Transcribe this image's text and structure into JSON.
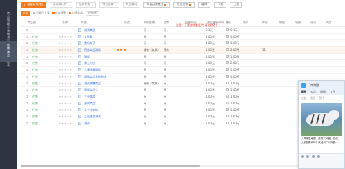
{
  "nav": {
    "groups": [
      {
        "chars": [
          "商",
          "品",
          "管",
          "理"
        ]
      },
      {
        "chars": [
          "订",
          "单",
          "物",
          "流"
        ]
      },
      {
        "chars": [
          "采",
          "购",
          "仓",
          "储"
        ]
      },
      {
        "chars": [
          "数",
          "据",
          "报",
          "表"
        ]
      }
    ],
    "active_chars": [
      "店",
      "铺",
      "商",
      "品"
    ]
  },
  "toolbar": {
    "add_label": "批量新增商品",
    "filters": [
      "请选择分类",
      "全部状态",
      "商品名称",
      "商品编码"
    ],
    "buttons": [
      "导出已选商品",
      "导出全部",
      "删除",
      "下架",
      "上架"
    ]
  },
  "row2": {
    "chip": "全部",
    "checks": [
      "只看已上架",
      "库存预警",
      "价格异常"
    ],
    "sort_label": "按排序"
  },
  "table": {
    "headers": [
      "商品图",
      "名称",
      "标题",
      "分类",
      "所属店铺",
      "品牌",
      "创建时间",
      "最近更新时间",
      "售价",
      "原价",
      "库存",
      "销量",
      "收藏",
      "评论",
      "浏览",
      "排序"
    ],
    "red_header": "注意：不要修改重复的(请勿修改)",
    "rows": [
      {
        "price": "0.1元",
        "orig": "0.1元",
        "name": "测试商品",
        "store": "无",
        "brand": "无",
        "sort": ""
      },
      {
        "price": "1.00元",
        "orig": "1.00元",
        "name": "女款鞋",
        "store": "无",
        "brand": "无",
        "sort": "",
        "status": "在售",
        "stars": "★★★★★"
      },
      {
        "price": "1.00元",
        "orig": "1.00元",
        "name": "数码电子",
        "store": "无",
        "brand": "无",
        "sort": "",
        "status": "在售",
        "stars": "★★★★★"
      },
      {
        "price": "1.00元",
        "orig": "2.00元",
        "name": "预售商品测试",
        "store": "服装（女装）",
        "brand": "预售",
        "sort": "11",
        "status": "在售",
        "stars": "★★★★★",
        "highlight": true
      },
      {
        "price": "1.00元",
        "orig": "1.00元",
        "name": "测试",
        "store": "无",
        "brand": "无",
        "sort": "",
        "status": "在售",
        "stars": "★★★★★"
      },
      {
        "price": "1.00元",
        "orig": "2.00元",
        "name": "男士衬衫",
        "store": "无",
        "brand": "无",
        "sort": "",
        "status": "在售",
        "stars": "★★★★★"
      },
      {
        "price": "1.00元",
        "orig": "1.00元",
        "name": "儿童玩具测试",
        "store": "无",
        "brand": "无",
        "sort": "",
        "status": "在售",
        "stars": "★★★★★"
      },
      {
        "price": "1.00元",
        "orig": "1.00元",
        "name": "测试商品名称测试",
        "store": "无",
        "brand": "无",
        "sort": "",
        "status": "在售",
        "stars": "★★★★★"
      },
      {
        "price": "1.00元",
        "orig": "1.00元",
        "name": "测试预售商品",
        "store": "服装（女装）",
        "brand": "无",
        "sort": "",
        "status": "在售",
        "stars": "★★★★★"
      },
      {
        "price": "1.00元",
        "orig": "1.00元",
        "name": "测试商品·2",
        "store": "无",
        "brand": "无",
        "sort": "",
        "status": "在售",
        "stars": "★★★★★"
      },
      {
        "price": "1.00元",
        "orig": "1.00元",
        "name": "三亚旅游",
        "store": "无",
        "brand": "无",
        "sort": "",
        "status": "在售",
        "stars": "★★★★★"
      },
      {
        "price": "1.00元",
        "orig": "1.00元",
        "name": "测试商品",
        "store": "无",
        "brand": "无",
        "sort": "",
        "status": "在售",
        "stars": "★★★★★"
      },
      {
        "price": "1.00元",
        "orig": "1.00元",
        "name": "女士连衣裙",
        "store": "无",
        "brand": "无",
        "sort": "",
        "status": "在售",
        "stars": "★★★★★"
      },
      {
        "price": "1.00元",
        "orig": "1.00元",
        "name": "三亚旅游测试",
        "store": "无",
        "brand": "无",
        "sort": "",
        "status": "在售",
        "stars": "★★★★★"
      },
      {
        "price": "1.00元",
        "orig": "1.00元",
        "name": "测试",
        "store": "无",
        "brand": "无",
        "sort": "",
        "status": "在售",
        "stars": "★★★★★"
      }
    ]
  },
  "chat": {
    "title": "广州海园",
    "tabs": [
      "聊天",
      "公告",
      "相册",
      "文件"
    ],
    "sub": [
      "全部",
      "精选",
      "图片"
    ],
    "text": "八哥林湿地图，美丽又可爱，白虎，大家都喜欢吗？欢迎到广州海园..."
  },
  "colors": {
    "accent": "#f37b1d",
    "nav_bg": "#2e3440",
    "link": "#2d6cdf",
    "status_green": "#41a85f"
  }
}
